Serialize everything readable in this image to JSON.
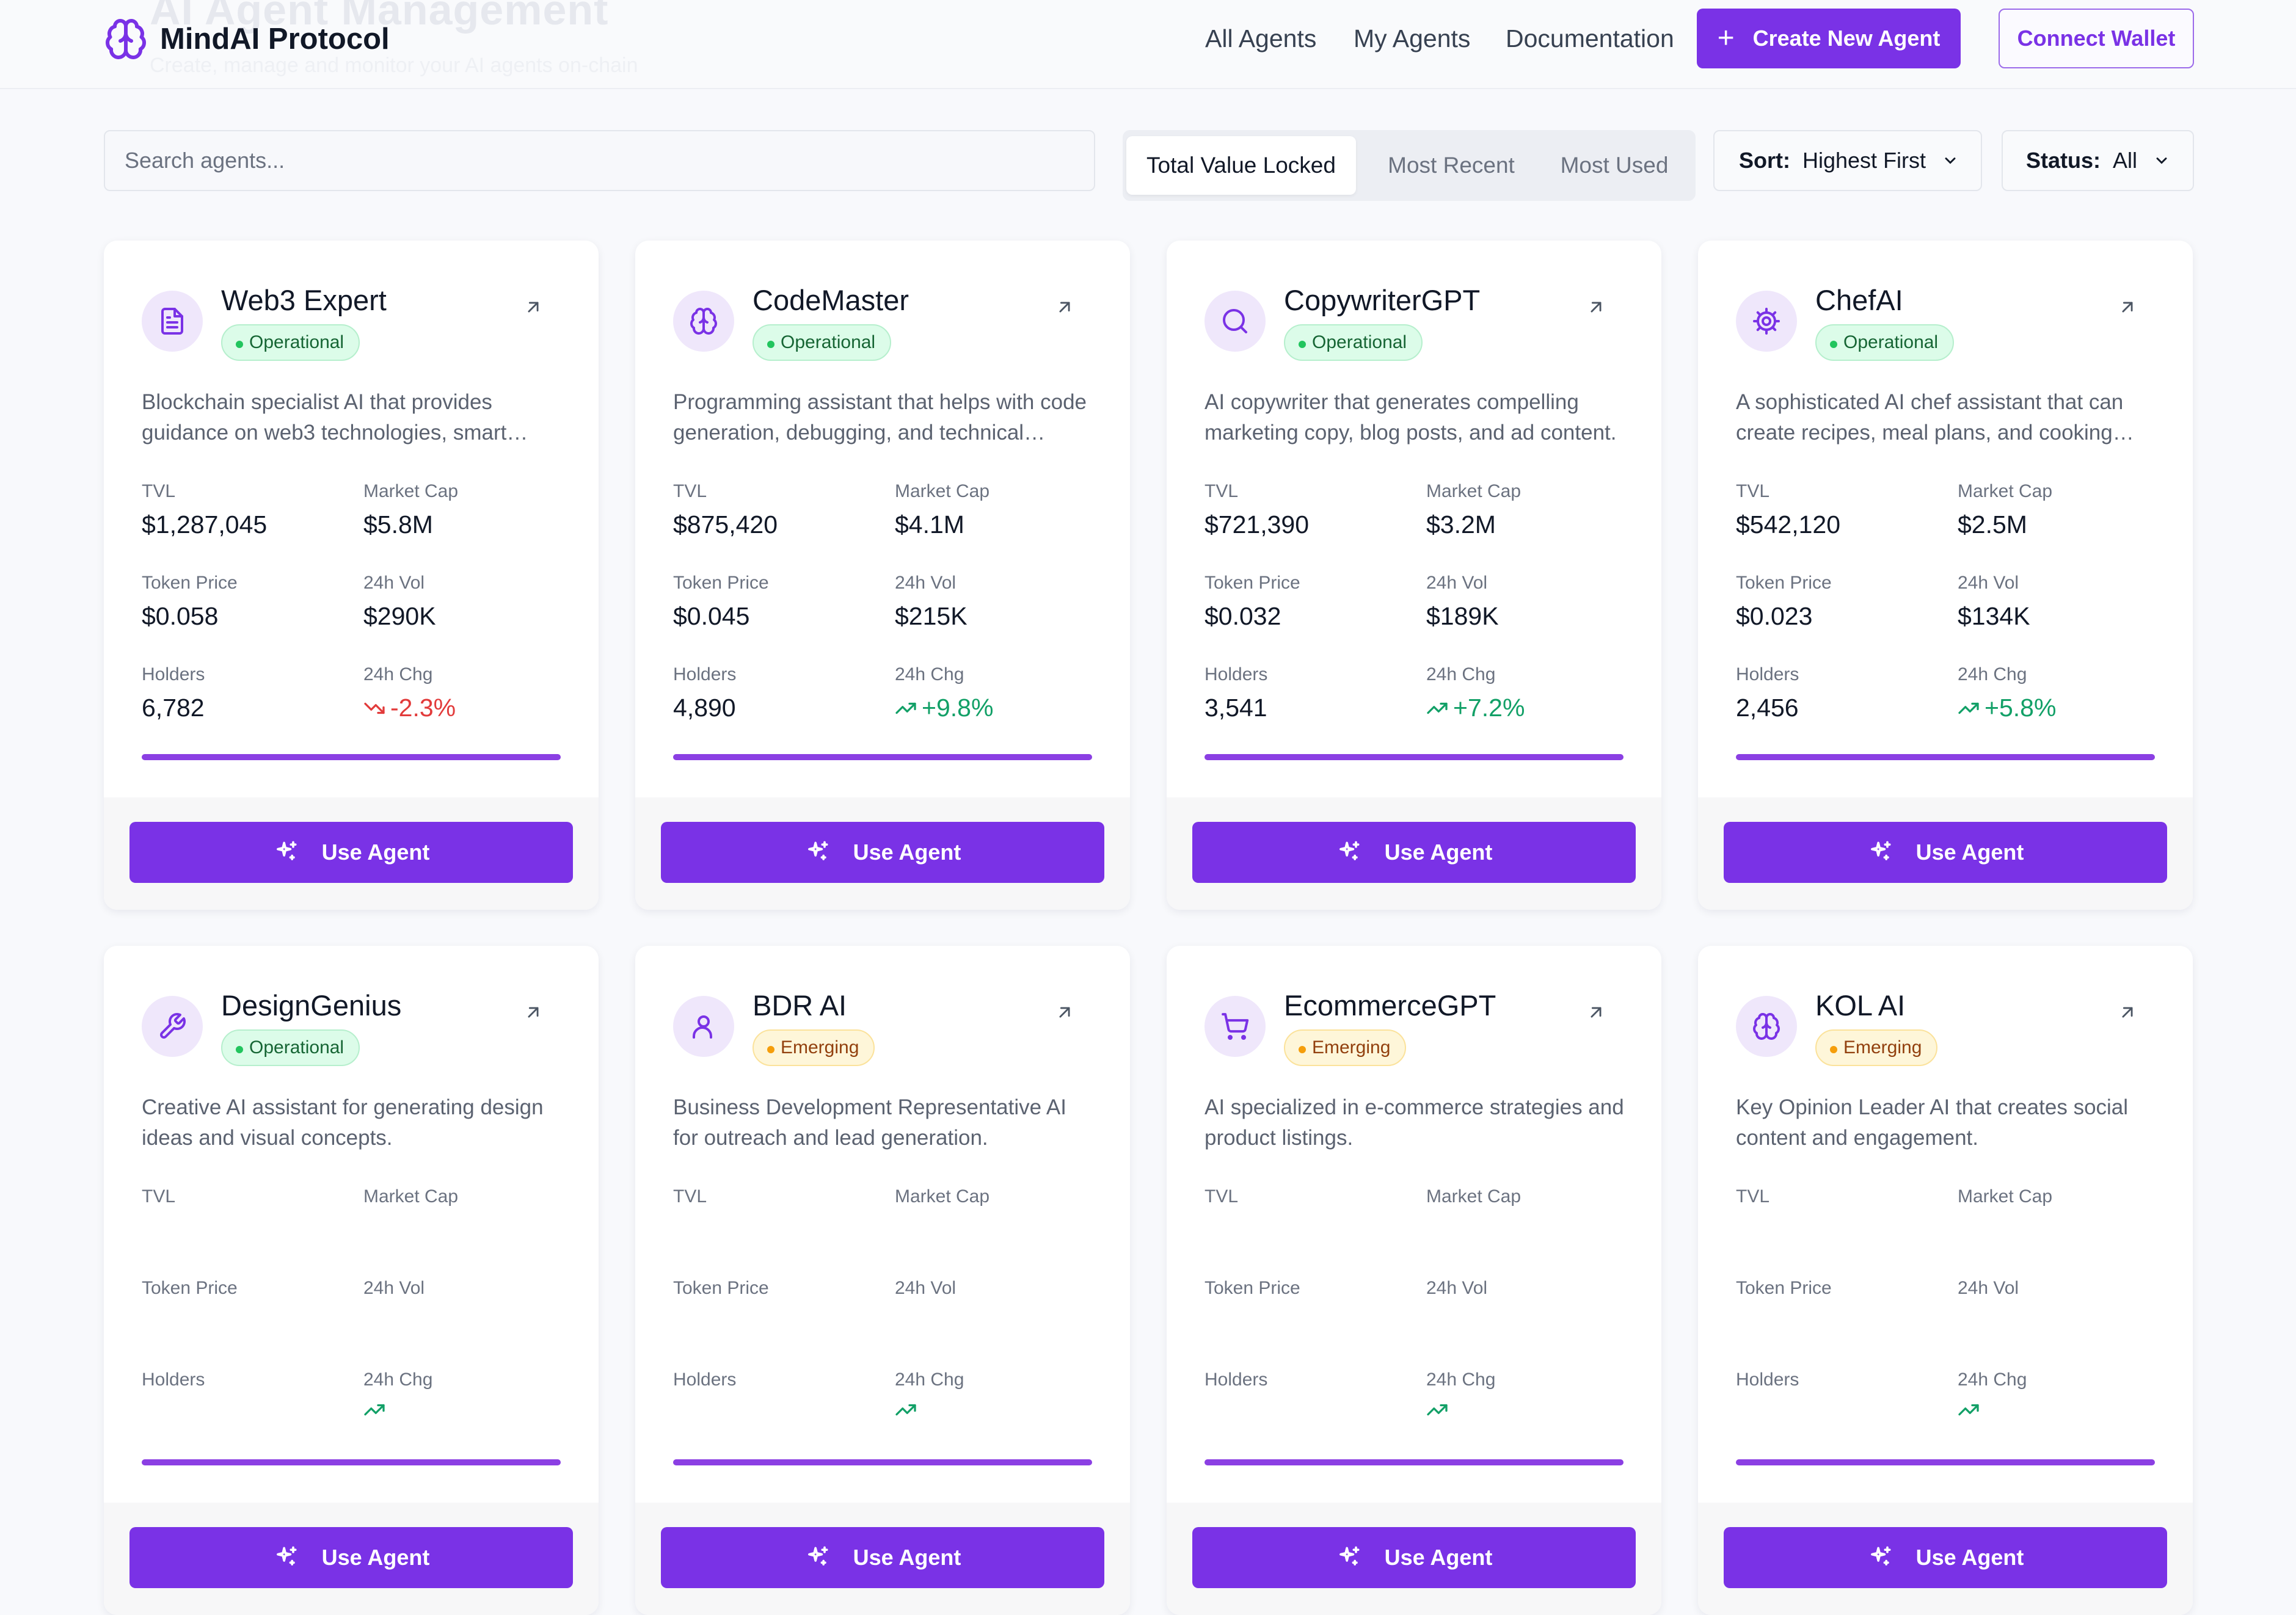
{
  "header": {
    "ghost_title": "AI Agent Management",
    "ghost_subtitle": "Create, manage and monitor your AI agents on-chain",
    "brand": "MindAI Protocol",
    "nav": [
      "All Agents",
      "My Agents",
      "Documentation"
    ],
    "create_label": "Create New Agent",
    "connect_label": "Connect Wallet"
  },
  "filters": {
    "search_placeholder": "Search agents...",
    "tabs": [
      "Total Value Locked",
      "Most Recent",
      "Most Used"
    ],
    "active_tab": "Total Value Locked",
    "sort_label": "Sort:",
    "sort_value": "Highest First",
    "status_label": "Status:",
    "status_value": "All"
  },
  "metric_labels": {
    "tvl": "TVL",
    "mcap": "Market Cap",
    "price": "Token Price",
    "vol": "24h Vol",
    "holders": "Holders",
    "chg": "24h Chg"
  },
  "use_label": "Use Agent",
  "colors": {
    "accent": "#7a32e6",
    "up": "#12a067",
    "down": "#e23b3b"
  },
  "agents": [
    {
      "name": "Web3 Expert",
      "status": "Operational",
      "icon": "document-icon",
      "description": "Blockchain specialist AI that provides guidance on web3 technologies, smart contracts, and DeFi protocols.",
      "tvl": "$1,287,045",
      "mcap": "$5.8M",
      "price": "$0.058",
      "vol": "$290K",
      "holders": "6,782",
      "chg": "-2.3%",
      "trend": "down",
      "progress": 1.0
    },
    {
      "name": "CodeMaster",
      "status": "Operational",
      "icon": "brain-icon",
      "description": "Programming assistant that helps with code generation, debugging, and technical documentation.",
      "tvl": "$875,420",
      "mcap": "$4.1M",
      "price": "$0.045",
      "vol": "$215K",
      "holders": "4,890",
      "chg": "+9.8%",
      "trend": "up",
      "progress": 1.0
    },
    {
      "name": "CopywriterGPT",
      "status": "Operational",
      "icon": "search-icon",
      "description": "AI copywriter that generates compelling marketing copy, blog posts, and ad content.",
      "tvl": "$721,390",
      "mcap": "$3.2M",
      "price": "$0.032",
      "vol": "$189K",
      "holders": "3,541",
      "chg": "+7.2%",
      "trend": "up",
      "progress": 1.0
    },
    {
      "name": "ChefAI",
      "status": "Operational",
      "icon": "gear-icon",
      "description": "A sophisticated AI chef assistant that can create recipes, meal plans, and cooking guidance.",
      "tvl": "$542,120",
      "mcap": "$2.5M",
      "price": "$0.023",
      "vol": "$134K",
      "holders": "2,456",
      "chg": "+5.8%",
      "trend": "up",
      "progress": 1.0
    },
    {
      "name": "DesignGenius",
      "status": "Operational",
      "icon": "wrench-icon",
      "description": "Creative AI assistant for generating design ideas and visual concepts.",
      "tvl": "",
      "mcap": "",
      "price": "",
      "vol": "",
      "holders": "",
      "chg": "",
      "trend": "up",
      "progress": 1.0
    },
    {
      "name": "BDR AI",
      "status": "Emerging",
      "icon": "user-icon",
      "description": "Business Development Representative AI for outreach and lead generation.",
      "tvl": "",
      "mcap": "",
      "price": "",
      "vol": "",
      "holders": "",
      "chg": "",
      "trend": "up",
      "progress": 1.0
    },
    {
      "name": "EcommerceGPT",
      "status": "Emerging",
      "icon": "cart-icon",
      "description": "AI specialized in e-commerce strategies and product listings.",
      "tvl": "",
      "mcap": "",
      "price": "",
      "vol": "",
      "holders": "",
      "chg": "",
      "trend": "up",
      "progress": 1.0
    },
    {
      "name": "KOL AI",
      "status": "Emerging",
      "icon": "brain-icon",
      "description": "Key Opinion Leader AI that creates social content and engagement.",
      "tvl": "",
      "mcap": "",
      "price": "",
      "vol": "",
      "holders": "",
      "chg": "",
      "trend": "up",
      "progress": 1.0
    }
  ]
}
